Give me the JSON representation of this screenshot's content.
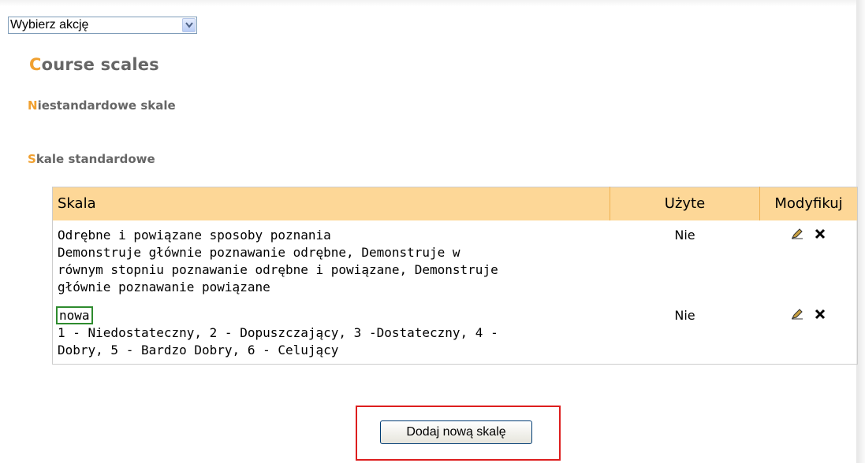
{
  "action_select": {
    "value": "Wybierz akcję"
  },
  "page_title": {
    "first": "C",
    "rest": "ourse scales"
  },
  "custom_heading": {
    "first": "N",
    "rest": "iestandardowe skale"
  },
  "standard_heading": {
    "first": "S",
    "rest": "kale standardowe"
  },
  "table": {
    "headers": {
      "scale": "Skala",
      "used": "Użyte",
      "modify": "Modyfikuj"
    },
    "rows": [
      {
        "name": "Odrębne i powiązane sposoby poznania",
        "items_line1": "Demonstruje głównie poznawanie odrębne, Demonstruje w",
        "items_line2": "równym stopniu poznawanie odrębne i powiązane, Demonstruje",
        "items_line3": "głównie poznawanie powiązane",
        "used": "Nie"
      },
      {
        "name": "nowa",
        "items_line1": "1 - Niedostateczny, 2 - Dopuszczający, 3 -Dostateczny, 4 -",
        "items_line2": "Dobry, 5 - Bardzo Dobry, 6 - Celujący",
        "used": "Nie"
      }
    ]
  },
  "add_button": {
    "label": "Dodaj nową skalę"
  },
  "colors": {
    "header_bg": "#fdd797",
    "accent": "#f0a030",
    "highlight_green": "#2e8b2e",
    "highlight_red": "#dd1e1e"
  },
  "icons": {
    "edit": "edit-icon",
    "delete": "delete-icon",
    "dropdown": "chevron-down-icon"
  }
}
